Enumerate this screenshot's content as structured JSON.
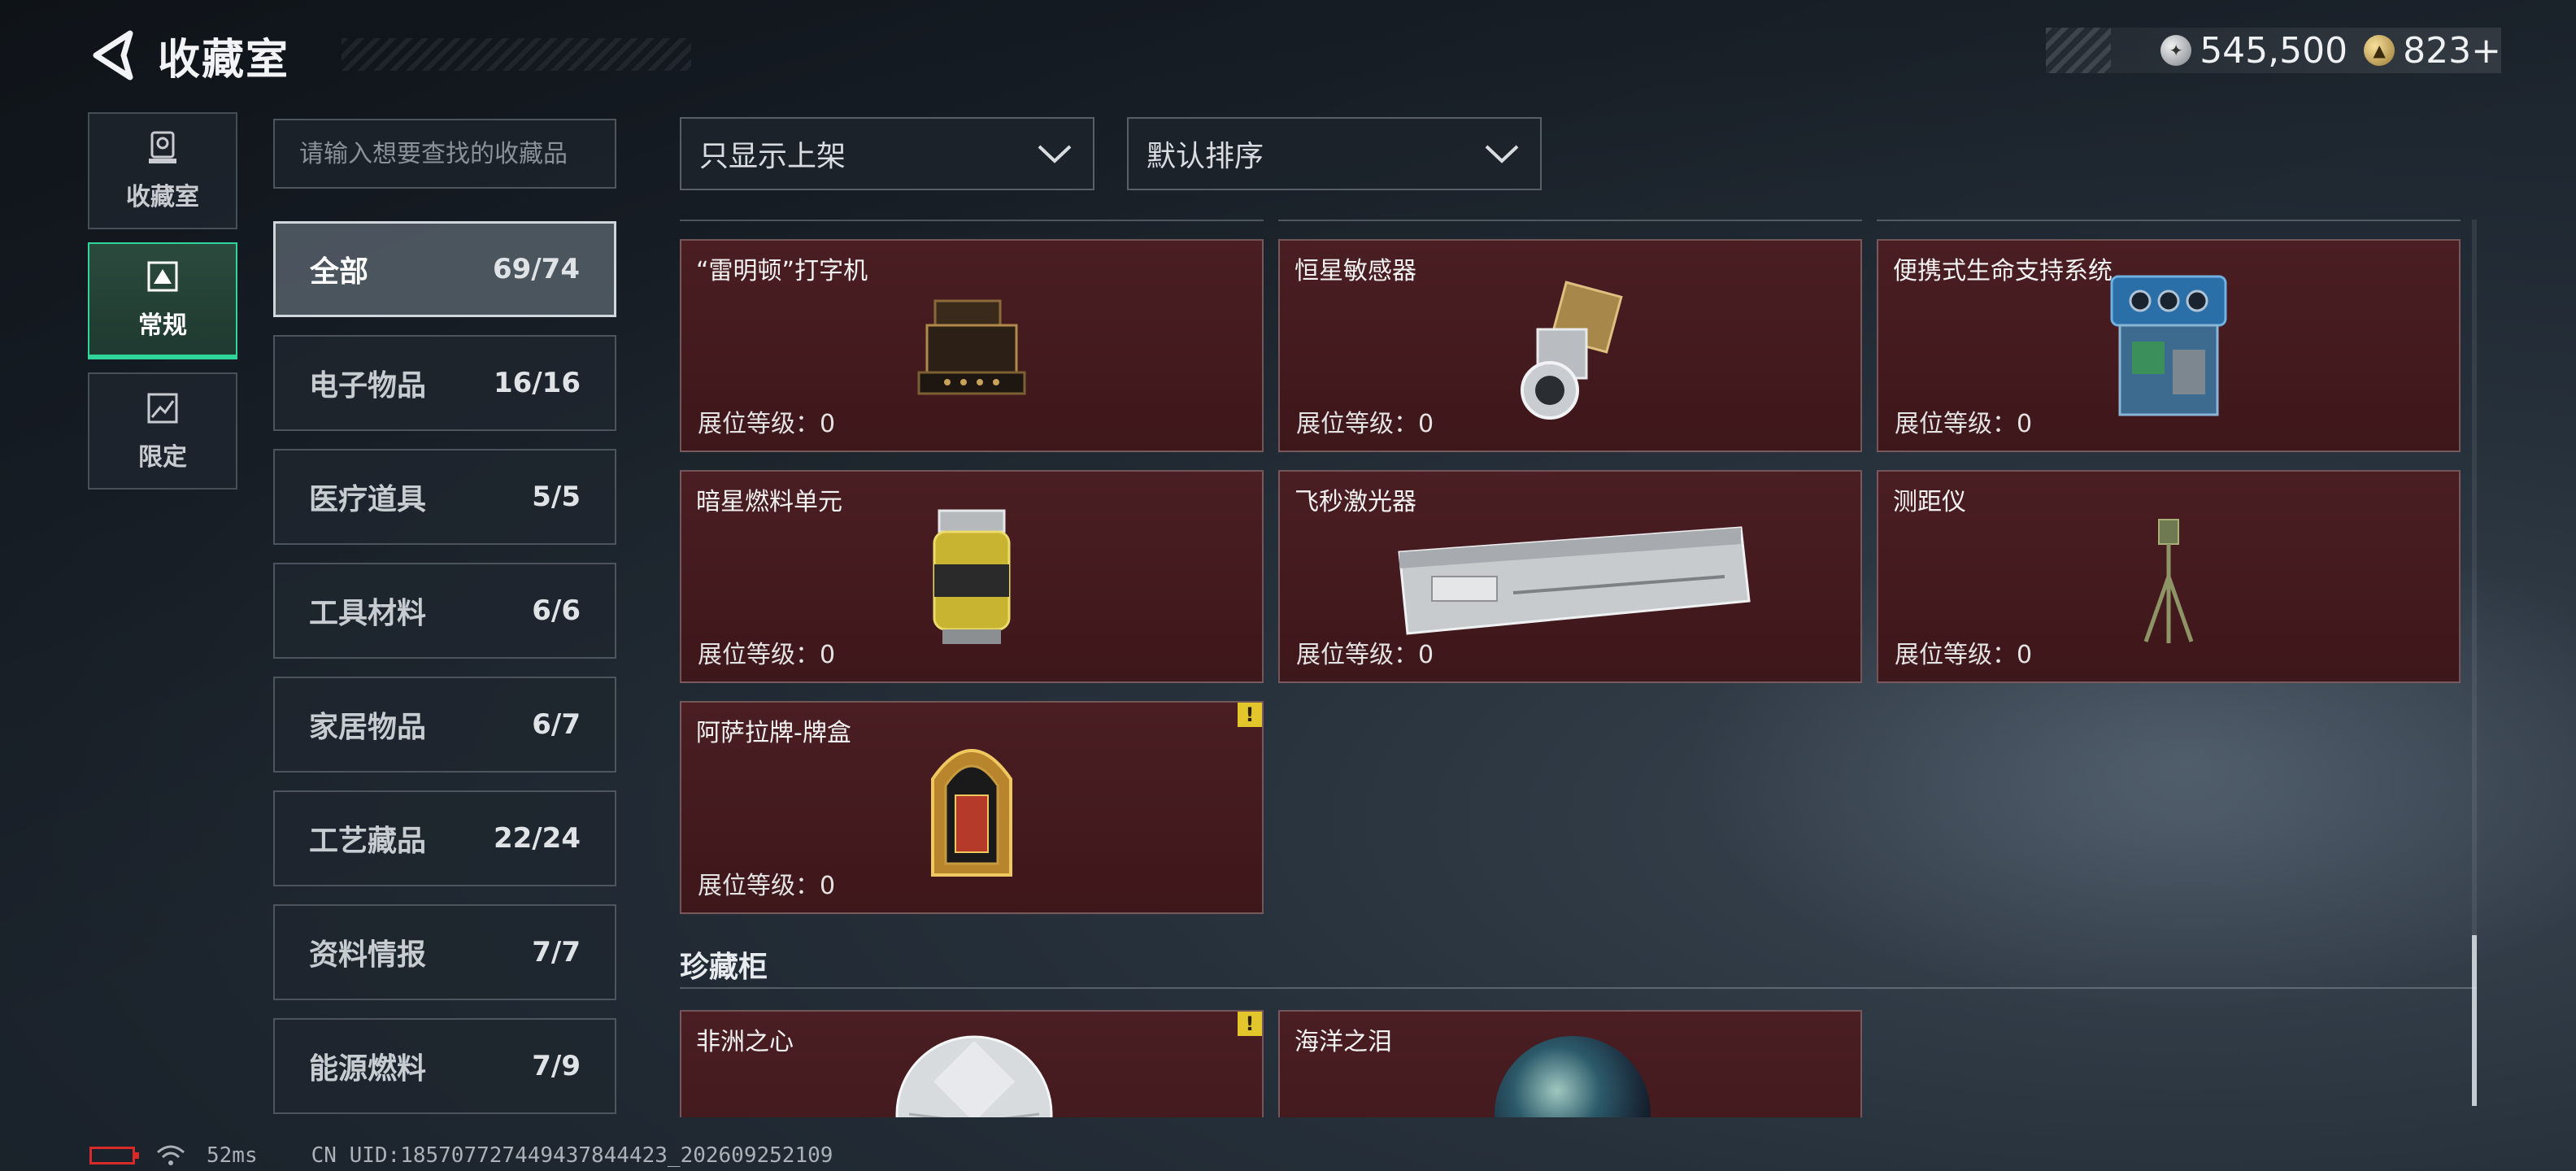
{
  "header": {
    "title": "收藏室",
    "currency_silver": "545,500",
    "currency_gold": "823+"
  },
  "left_nav": [
    {
      "label": "收藏室",
      "icon": "trophy-icon",
      "active": false
    },
    {
      "label": "常规",
      "icon": "collection-frame-icon",
      "active": true
    },
    {
      "label": "限定",
      "icon": "limited-frame-icon",
      "active": false
    }
  ],
  "search": {
    "placeholder": "请输入想要查找的收藏品"
  },
  "categories": [
    {
      "label": "全部",
      "count": "69/74",
      "active": true
    },
    {
      "label": "电子物品",
      "count": "16/16"
    },
    {
      "label": "医疗道具",
      "count": "5/5"
    },
    {
      "label": "工具材料",
      "count": "6/6"
    },
    {
      "label": "家居物品",
      "count": "6/7"
    },
    {
      "label": "工艺藏品",
      "count": "22/24"
    },
    {
      "label": "资料情报",
      "count": "7/7"
    },
    {
      "label": "能源燃料",
      "count": "7/9"
    }
  ],
  "filters": {
    "display_filter": "只显示上架",
    "sort_order": "默认排序"
  },
  "items": [
    {
      "name": "“雷明顿”打字机",
      "level": "展位等级：0",
      "alert": false
    },
    {
      "name": "恒星敏感器",
      "level": "展位等级：0",
      "alert": false
    },
    {
      "name": "便携式生命支持系统",
      "level": "展位等级：0",
      "alert": false
    },
    {
      "name": "暗星燃料单元",
      "level": "展位等级：0",
      "alert": false
    },
    {
      "name": "飞秒激光器",
      "level": "展位等级：0",
      "alert": false
    },
    {
      "name": "测距仪",
      "level": "展位等级：0",
      "alert": false
    },
    {
      "name": "阿萨拉牌-牌盒",
      "level": "展位等级：0",
      "alert": true
    }
  ],
  "showcase": {
    "title": "珍藏柜",
    "items": [
      {
        "name": "非洲之心",
        "alert": true
      },
      {
        "name": "海洋之泪",
        "alert": false
      }
    ]
  },
  "status": {
    "ping": "52ms",
    "uid": "CN UID:185707727449437844423_202609252109"
  },
  "colors": {
    "accent_green": "#2fd59a",
    "card_bg": "#4a1e22",
    "alert_yellow": "#e3c62b",
    "battery_red": "#d92a2a"
  }
}
